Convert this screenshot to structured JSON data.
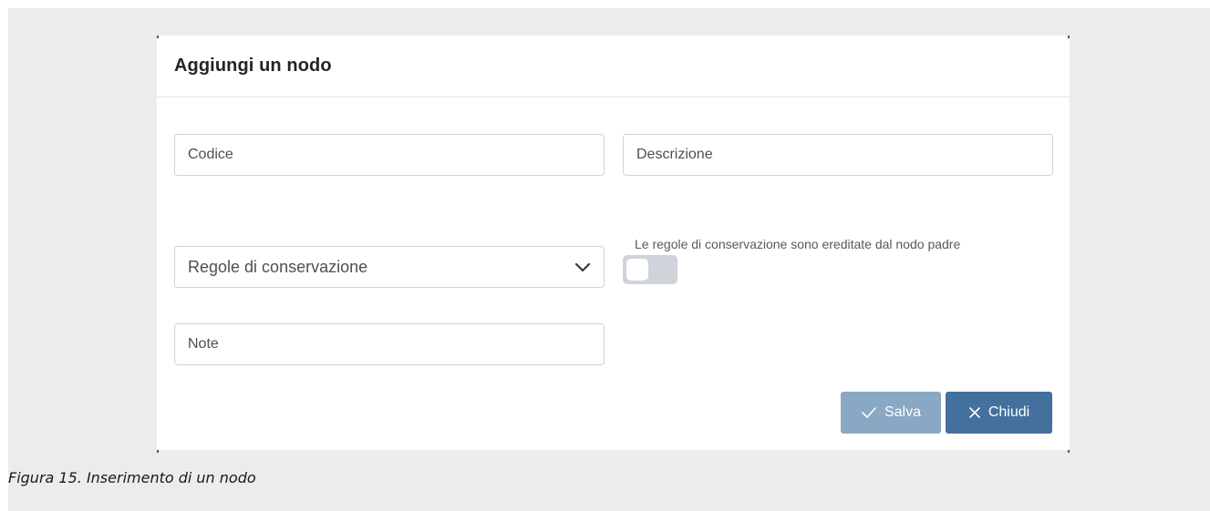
{
  "modal": {
    "title": "Aggiungi un nodo",
    "fields": {
      "codice": {
        "placeholder": "Codice",
        "value": ""
      },
      "descrizione": {
        "placeholder": "Descrizione",
        "value": ""
      },
      "regole": {
        "selected": "Regole di conservazione",
        "icon": "chevron-down-icon"
      },
      "note": {
        "placeholder": "Note",
        "value": ""
      }
    },
    "toggle": {
      "label": "Le regole di conservazione sono ereditate dal nodo padre",
      "state": "off"
    },
    "buttons": {
      "save_label": "Salva",
      "save_icon": "check-icon",
      "close_label": "Chiudi",
      "close_icon": "close-icon"
    }
  },
  "caption": "Figura 15. Inserimento di un nodo",
  "colors": {
    "background": "#ececec",
    "save_button": "#89a8c4",
    "close_button": "#43709d",
    "toggle_off": "#cfd4da"
  }
}
